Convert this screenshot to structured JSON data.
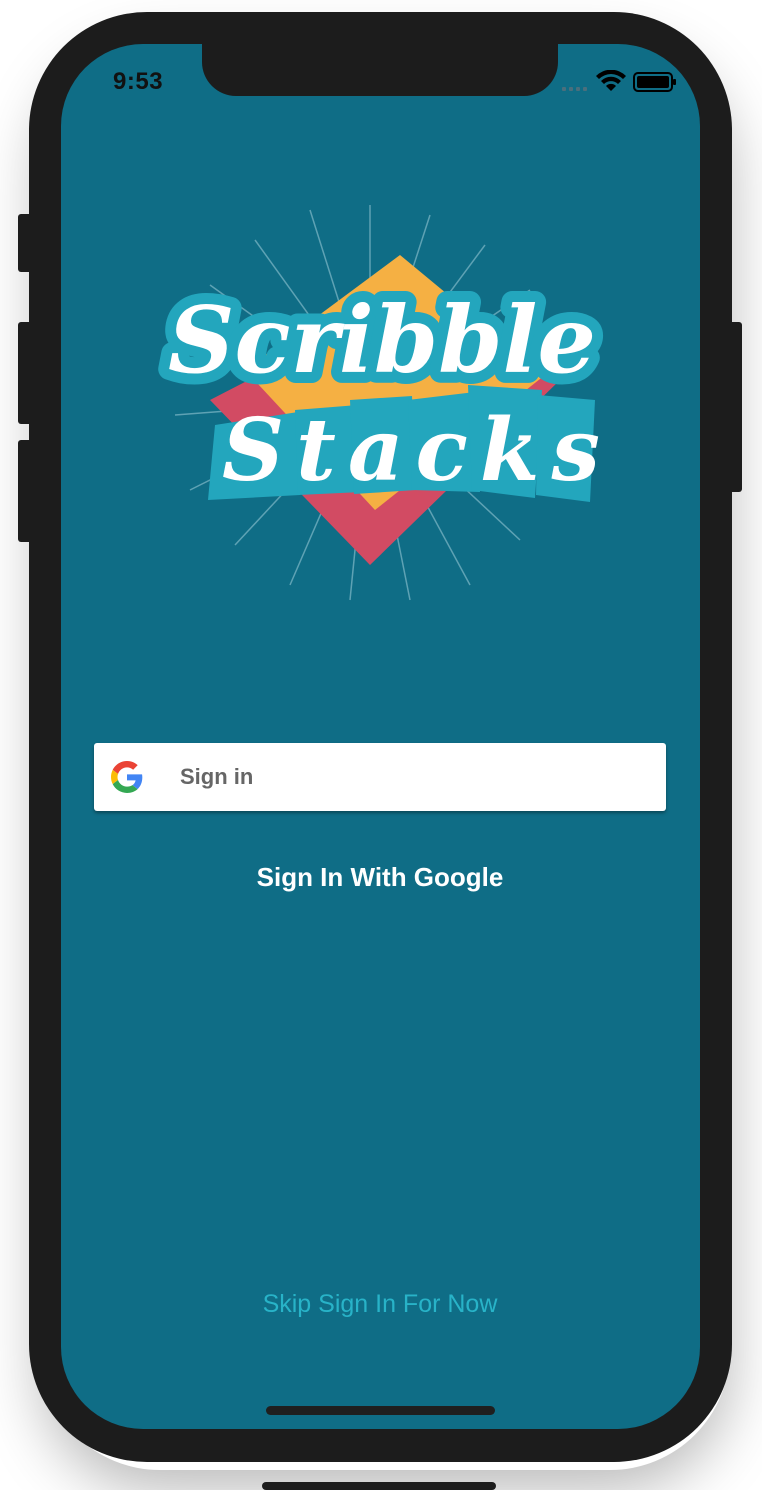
{
  "status_bar": {
    "time": "9:53"
  },
  "logo": {
    "line1": "Scribble",
    "line2": "Stacks"
  },
  "sign_in_button": {
    "label": "Sign in",
    "icon": "google-g-icon"
  },
  "google_text": "Sign In With Google",
  "skip_link": "Skip Sign In For Now",
  "colors": {
    "background": "#0f6d86",
    "accent_link": "#28b3c8",
    "logo_blue": "#23a6bd",
    "logo_yellow": "#f5b043",
    "logo_red": "#d24b63"
  }
}
